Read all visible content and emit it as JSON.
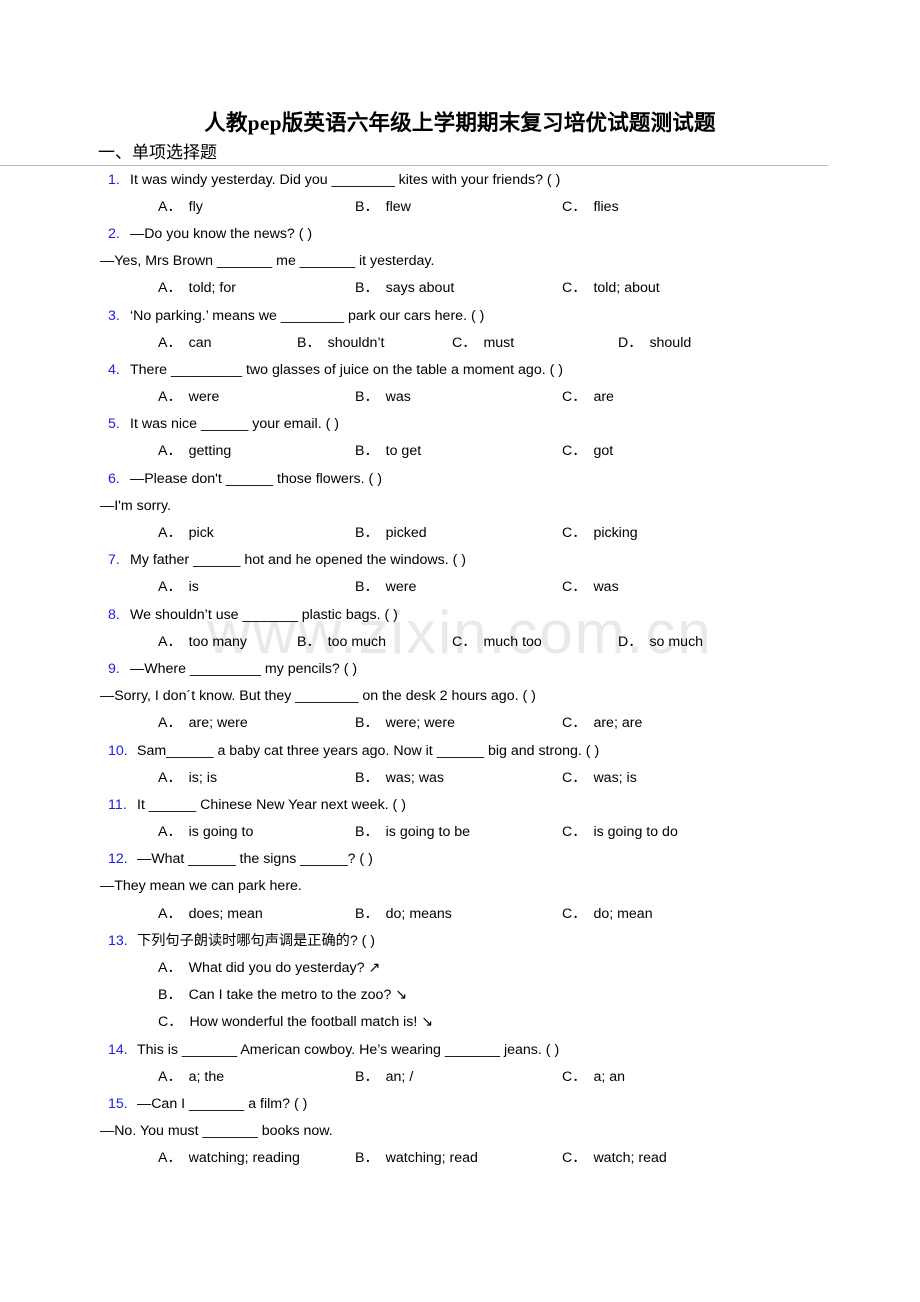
{
  "document": {
    "title": "人教pep版英语六年级上学期期末复习培优试题测试题",
    "watermark": "www.zixin.com.cn",
    "accent_color": "#2020dd",
    "section_heading": "一、单项选择题"
  },
  "questions": [
    {
      "num": "1.",
      "stem": "It was windy yesterday. Did you ________ kites with your friends? (    )",
      "continuation": null,
      "layout": "three",
      "options": [
        {
          "label": "A．",
          "text": "fly"
        },
        {
          "label": "B．",
          "text": "flew"
        },
        {
          "label": "C．",
          "text": "flies"
        }
      ]
    },
    {
      "num": "2.",
      "stem": "—Do you know the news? (    )",
      "continuation": "—Yes, Mrs Brown _______ me _______ it yesterday.",
      "layout": "three",
      "options": [
        {
          "label": "A．",
          "text": "told; for"
        },
        {
          "label": "B．",
          "text": "says about"
        },
        {
          "label": "C．",
          "text": "told; about"
        }
      ]
    },
    {
      "num": "3.",
      "stem": "‘No parking.’ means we ________ park our cars here. (    )",
      "continuation": null,
      "layout": "four",
      "options": [
        {
          "label": "A．",
          "text": "can"
        },
        {
          "label": "B．",
          "text": "shouldn’t"
        },
        {
          "label": "C．",
          "text": "must"
        },
        {
          "label": "D．",
          "text": "should"
        }
      ]
    },
    {
      "num": "4.",
      "stem": "There _________ two glasses of juice on the table a moment ago. (    )",
      "continuation": null,
      "layout": "three",
      "options": [
        {
          "label": "A．",
          "text": "were"
        },
        {
          "label": "B．",
          "text": "was"
        },
        {
          "label": "C．",
          "text": "are"
        }
      ]
    },
    {
      "num": "5.",
      "stem": "It was nice ______ your email. (    )",
      "continuation": null,
      "layout": "three",
      "options": [
        {
          "label": "A．",
          "text": "getting"
        },
        {
          "label": "B．",
          "text": "to get"
        },
        {
          "label": "C．",
          "text": "got"
        }
      ]
    },
    {
      "num": "6.",
      "stem": "—Please don't ______ those flowers. (    )",
      "continuation": "—I'm sorry.",
      "layout": "three",
      "options": [
        {
          "label": "A．",
          "text": "pick"
        },
        {
          "label": "B．",
          "text": "picked"
        },
        {
          "label": "C．",
          "text": "picking"
        }
      ]
    },
    {
      "num": "7.",
      "stem": "My father ______ hot and he opened the windows. (    )",
      "continuation": null,
      "layout": "three",
      "options": [
        {
          "label": "A．",
          "text": "is"
        },
        {
          "label": "B．",
          "text": "were"
        },
        {
          "label": "C．",
          "text": "was"
        }
      ]
    },
    {
      "num": "8.",
      "stem": "We shouldn’t use _______ plastic bags. (    )",
      "continuation": null,
      "layout": "four",
      "options": [
        {
          "label": "A．",
          "text": "too many"
        },
        {
          "label": "B．",
          "text": "too much"
        },
        {
          "label": "C．",
          "text": "much too"
        },
        {
          "label": "D．",
          "text": "so much"
        }
      ]
    },
    {
      "num": "9.",
      "stem": "—Where _________ my pencils? (    )",
      "continuation": "—Sorry, I don´t know. But they ________ on the desk 2 hours ago. (    )",
      "layout": "three",
      "options": [
        {
          "label": "A．",
          "text": "are; were"
        },
        {
          "label": "B．",
          "text": "were; were"
        },
        {
          "label": "C．",
          "text": "are; are"
        }
      ]
    },
    {
      "num": "10.",
      "stem": "Sam______ a baby cat three years ago. Now it ______ big and strong. (    )",
      "continuation": null,
      "layout": "three",
      "options": [
        {
          "label": "A．",
          "text": "is; is"
        },
        {
          "label": "B．",
          "text": "was; was"
        },
        {
          "label": "C．",
          "text": "was; is"
        }
      ]
    },
    {
      "num": "11.",
      "stem": "It ______ Chinese New Year next week. (    )",
      "continuation": null,
      "layout": "three",
      "options": [
        {
          "label": "A．",
          "text": "is going to"
        },
        {
          "label": "B．",
          "text": "is going to be"
        },
        {
          "label": "C．",
          "text": "is going to do"
        }
      ]
    },
    {
      "num": "12.",
      "stem": "—What ______ the signs ______? (    )",
      "continuation": "—They mean we can park here.",
      "layout": "three",
      "options": [
        {
          "label": "A．",
          "text": "does; mean"
        },
        {
          "label": "B．",
          "text": "do; means"
        },
        {
          "label": "C．",
          "text": "do; mean"
        }
      ]
    },
    {
      "num": "13.",
      "stem": "下列句子朗读时哪句声调是正确的? (  )",
      "continuation": null,
      "layout": "stacked",
      "options": [
        {
          "label": "A．",
          "text": "What did you do yesterday? ↗"
        },
        {
          "label": "B．",
          "text": "Can I take the metro to the zoo? ↘"
        },
        {
          "label": "C．",
          "text": "How wonderful the football match is! ↘"
        }
      ]
    },
    {
      "num": "14.",
      "stem": "This is _______ American cowboy. He’s wearing _______ jeans. (    )",
      "continuation": null,
      "layout": "three",
      "options": [
        {
          "label": "A．",
          "text": "a; the"
        },
        {
          "label": "B．",
          "text": "an; /"
        },
        {
          "label": "C．",
          "text": "a; an"
        }
      ]
    },
    {
      "num": "15.",
      "stem": "—Can I _______ a film? (    )",
      "continuation": "—No. You must _______ books now.",
      "layout": "three",
      "options": [
        {
          "label": "A．",
          "text": "watching; reading"
        },
        {
          "label": "B．",
          "text": "watching; read"
        },
        {
          "label": "C．",
          "text": "watch; read"
        }
      ]
    }
  ]
}
